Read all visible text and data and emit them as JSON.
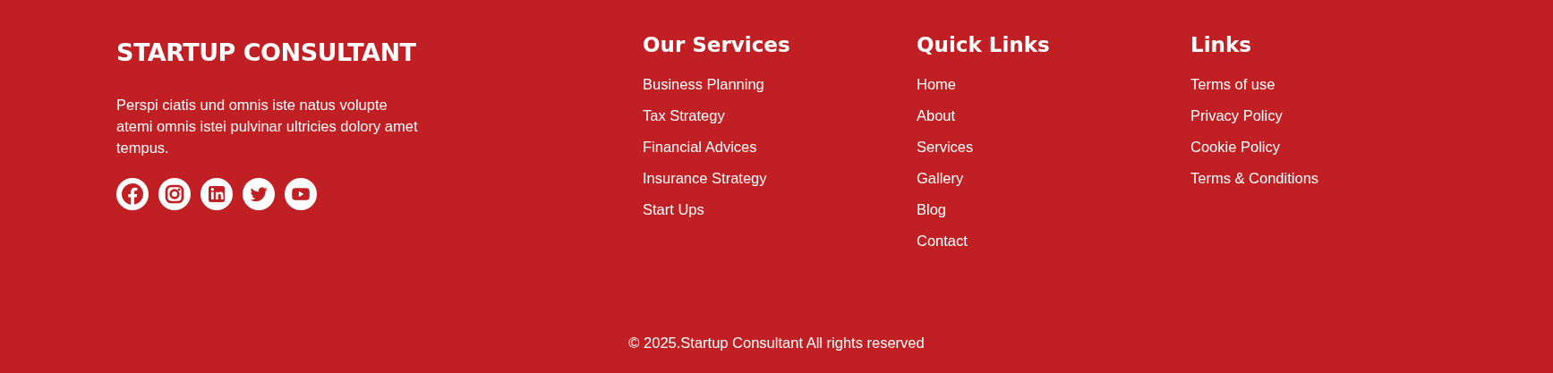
{
  "brand": {
    "title": "STARTUP CONSULTANT",
    "description": "Perspi ciatis und omnis iste natus volupte atemi omnis istei pulvinar ultricies dolory amet tempus."
  },
  "social_links": [
    {
      "kind": "facebook"
    },
    {
      "kind": "instagram"
    },
    {
      "kind": "linkedin"
    },
    {
      "kind": "twitter"
    },
    {
      "kind": "youtube"
    }
  ],
  "columns": [
    {
      "heading": "Our Services",
      "items": [
        "Business Planning",
        "Tax Strategy",
        "Financial Advices",
        "Insurance Strategy",
        "Start Ups"
      ]
    },
    {
      "heading": "Quick Links",
      "items": [
        "Home",
        "About",
        "Services",
        "Gallery",
        "Blog",
        "Contact"
      ]
    },
    {
      "heading": "Links",
      "items": [
        "Terms of use",
        "Privacy Policy",
        "Cookie Policy",
        "Terms & Conditions"
      ]
    }
  ],
  "copyright": "© 2025.Startup Consultant All rights reserved"
}
